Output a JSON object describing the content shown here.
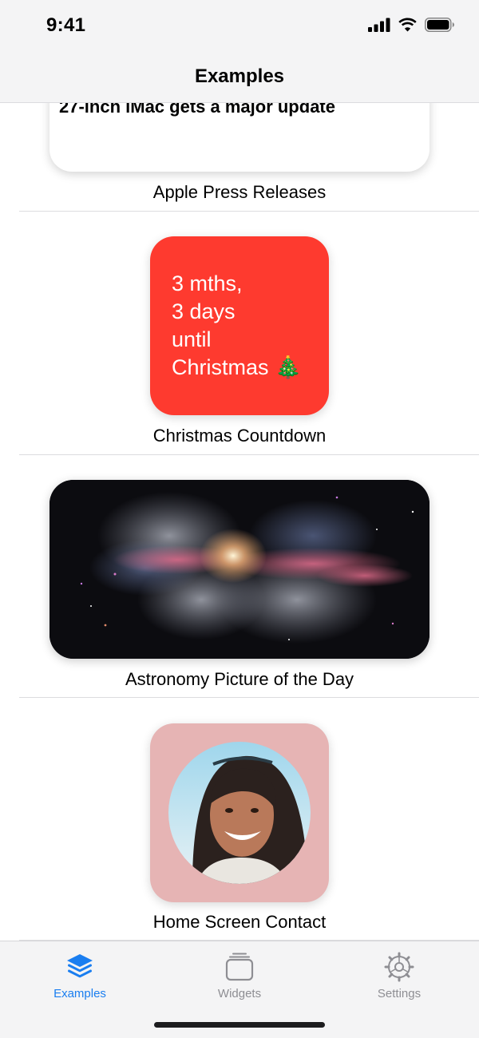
{
  "status_bar": {
    "time": "9:41"
  },
  "nav": {
    "title": "Examples"
  },
  "examples": [
    {
      "caption": "Apple Press Releases",
      "headline": "27-inch iMac gets a major update"
    },
    {
      "caption": "Christmas Countdown",
      "countdown_lines": [
        "3 mths,",
        "3 days",
        "until",
        "Christmas 🎄"
      ]
    },
    {
      "caption": "Astronomy Picture of the Day"
    },
    {
      "caption": "Home Screen Contact"
    }
  ],
  "tabs": [
    {
      "label": "Examples",
      "icon": "layers-icon",
      "selected": true
    },
    {
      "label": "Widgets",
      "icon": "widgets-stack-icon",
      "selected": false
    },
    {
      "label": "Settings",
      "icon": "gear-icon",
      "selected": false
    }
  ],
  "colors": {
    "accent": "#1a7ef0",
    "tab_inactive": "#8e8e93",
    "countdown_bg": "#fe3a2f",
    "contact_bg": "#e6b4b4"
  }
}
